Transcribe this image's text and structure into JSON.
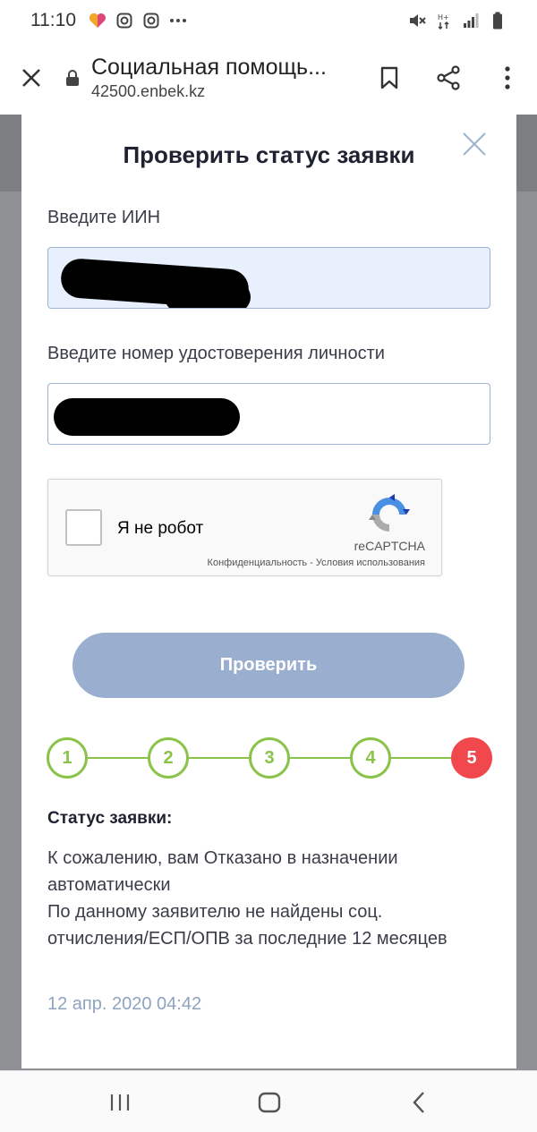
{
  "status_bar": {
    "time": "11:10",
    "icons_left": [
      "heart-app-icon",
      "instagram-icon",
      "instagram-icon",
      "more-dots-icon"
    ],
    "icons_right": [
      "mute-icon",
      "data-icon",
      "signal-icon",
      "battery-icon"
    ]
  },
  "browser": {
    "page_title": "Социальная помощь...",
    "url": "42500.enbek.kz"
  },
  "modal": {
    "title": "Проверить статус заявки",
    "iin_label": "Введите ИИН",
    "doc_label": "Введите номер удостоверения личности",
    "captcha": {
      "label": "Я не робот",
      "brand": "reCAPTCHA",
      "terms": "Конфиденциальность - Условия использования"
    },
    "submit_label": "Проверить",
    "steps": [
      "1",
      "2",
      "3",
      "4",
      "5"
    ],
    "current_step": 5,
    "status_heading": "Статус заявки:",
    "status_lines": [
      "К сожалению, вам Отказано в назначении автоматически",
      "По данному заявителю не найдены соц. отчисления/ЕСП/ОПВ за последние 12 месяцев"
    ],
    "status_date": "12 апр. 2020 04:42"
  },
  "colors": {
    "accent_green": "#8bc34a",
    "accent_red": "#f0484d",
    "button_blue": "#9aafd0"
  }
}
